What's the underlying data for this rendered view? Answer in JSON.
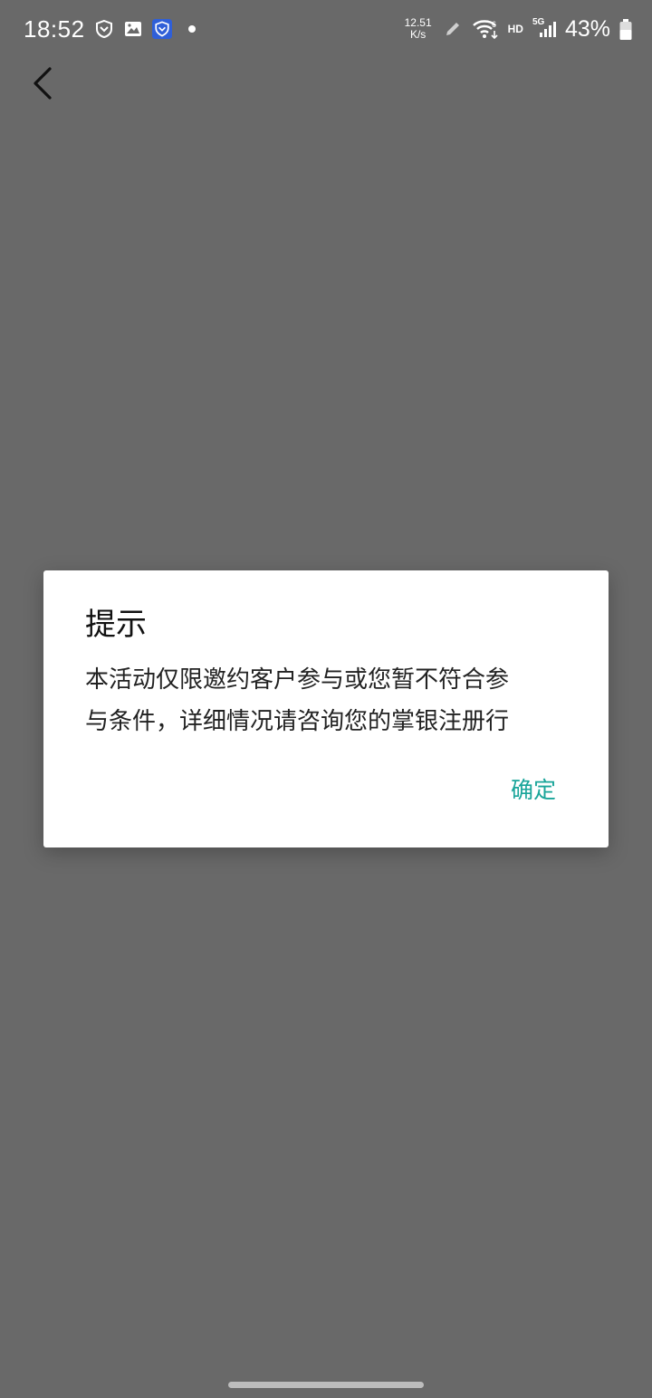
{
  "status_bar": {
    "time": "18:52",
    "net_speed_value": "12.51",
    "net_speed_unit": "K/s",
    "hd_label": "HD",
    "signal_label": "5G",
    "battery_percent": "43%",
    "wifi_badge": "6",
    "icons": [
      "shield-outline-icon",
      "image-icon",
      "shield-app-icon",
      "notification-dot-icon",
      "pen-icon",
      "wifi-icon",
      "signal-icon",
      "battery-icon"
    ]
  },
  "nav": {
    "back_icon": "chevron-left-icon"
  },
  "dialog": {
    "title": "提示",
    "message_line1": "本活动仅限邀约客户参与或您暂不符合参",
    "message_line2": "与条件，详细情况请咨询您的掌银注册行",
    "confirm_label": "确定"
  },
  "colors": {
    "overlay_background": "#696969",
    "dialog_background": "#ffffff",
    "accent": "#1aa59a",
    "app_icon_blue": "#2f5fd8"
  }
}
